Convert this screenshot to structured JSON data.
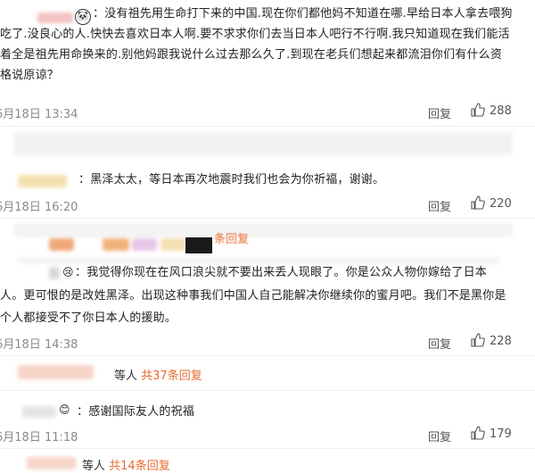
{
  "comments": [
    {
      "text_lines": [
        "：没有祖先用生命打下来的中国.现在你们都他妈不知道在哪.早给日本人拿去喂狗",
        "吃了.没良心的人.快快去喜欢日本人啊.要不求求你们去当日本人吧行不行啊.我只知道现在我们能活",
        "着全是祖先用命换来的.别他妈跟我说什么过去那么久了.到现在老兵们想起来都流泪你们有什么资",
        "格说原谅？"
      ],
      "time": "6月18日 13:34",
      "reply_label": "回复",
      "likes": "288"
    },
    {
      "text_lines": [
        "：黑泽太太，等日本再次地震时我们也会为你祈福，谢谢。"
      ],
      "time": "6月18日 16:20",
      "reply_label": "回复",
      "likes": "220",
      "sub_reply_fragment": "条回复"
    },
    {
      "text_lines": [
        "：我觉得你现在在风口浪尖就不要出来丢人现眼了。你是公众人物你嫁给了日本",
        "人。更可恨的是改姓黑泽。出现这种事我们中国人自己能解决你继续你的蜜月吧。我们不是黑你是",
        "个人都接受不了你日本人的援助。"
      ],
      "time": "6月18日 14:38",
      "reply_label": "回复",
      "likes": "228",
      "sub_reply_prefix": "等人",
      "sub_reply_count": "共37条回复"
    },
    {
      "text_lines": [
        "：感谢国际友人的祝福"
      ],
      "time": "6月18日 11:18",
      "reply_label": "回复",
      "likes": "179",
      "sub_reply_prefix": "等人",
      "sub_reply_count": "共14条回复"
    }
  ],
  "colors": {
    "link": "#e86a2e",
    "meta": "#8a8a8a"
  },
  "icons": [
    "thumb-up-icon",
    "avatar-blur"
  ]
}
